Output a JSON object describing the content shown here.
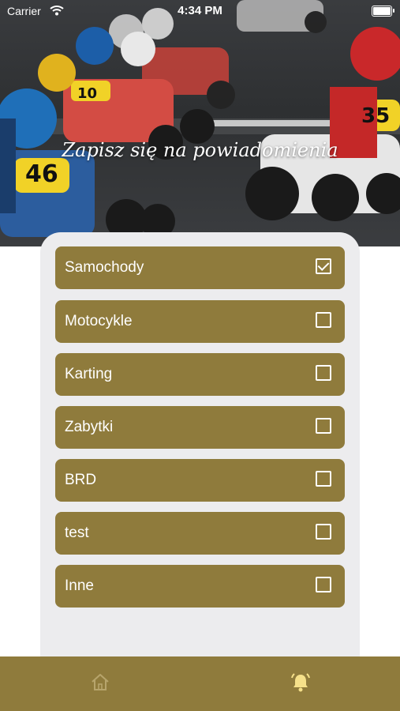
{
  "status_bar": {
    "carrier": "Carrier",
    "time": "4:34 PM"
  },
  "hero": {
    "title": "Zapisz się na powiadomienia"
  },
  "options": [
    {
      "label": "Samochody",
      "checked": true
    },
    {
      "label": "Motocykle",
      "checked": false
    },
    {
      "label": "Karting",
      "checked": false
    },
    {
      "label": "Zabytki",
      "checked": false
    },
    {
      "label": "BRD",
      "checked": false
    },
    {
      "label": "test",
      "checked": false
    },
    {
      "label": "Inne",
      "checked": false
    }
  ],
  "tabbar": {
    "tabs": [
      {
        "icon": "home-icon",
        "active": false
      },
      {
        "icon": "bell-icon",
        "active": true
      }
    ],
    "colors": {
      "background": "#8f7b3c",
      "active": "#f5e08a",
      "inactive": "#b7a56c"
    }
  },
  "colors": {
    "accent": "#8f7b3c",
    "panel": "#ececee"
  }
}
